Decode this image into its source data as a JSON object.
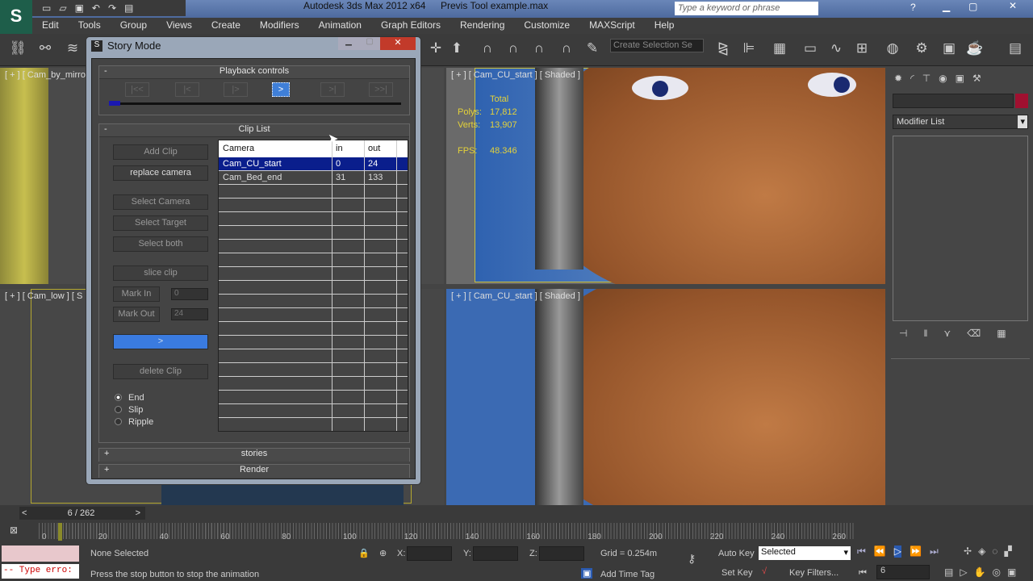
{
  "app": {
    "title": "Autodesk 3ds Max  2012 x64",
    "file": "Previs Tool example.max",
    "search_placeholder": "Type a keyword or phrase"
  },
  "menu": [
    "Edit",
    "Tools",
    "Group",
    "Views",
    "Create",
    "Modifiers",
    "Animation",
    "Graph Editors",
    "Rendering",
    "Customize",
    "MAXScript",
    "Help"
  ],
  "toolbar": {
    "selection_set": "Create Selection Se"
  },
  "viewports": {
    "top_left": "[ + ] [ Cam_by_mirror",
    "bottom_left": "[ + ] [ Cam_low ] [ S",
    "top_right": "[ + ] [ Cam_CU_start ] [ Shaded ]",
    "bottom_right": "[ + ] [ Cam_CU_start ] [ Shaded ]",
    "stats": {
      "total_label": "Total",
      "polys_label": "Polys:",
      "polys": "17,812",
      "verts_label": "Verts:",
      "verts": "13,907",
      "fps_label": "FPS:",
      "fps": "48.346"
    }
  },
  "command_panel": {
    "modifier_list": "Modifier List"
  },
  "dialog": {
    "title": "Story Mode",
    "playback": {
      "header": "Playback controls",
      "collapse": "-",
      "buttons": [
        "|<<",
        "|<",
        "|>",
        ">",
        ">|",
        ">>|"
      ],
      "progress": 0.02
    },
    "clip_list": {
      "header": "Clip List",
      "collapse": "-",
      "buttons": {
        "add": "Add Clip",
        "replace": "replace camera",
        "select_camera": "Select Camera",
        "select_target": "Select Target",
        "select_both": "Select both",
        "slice": "slice clip",
        "mark_in": "Mark In",
        "mark_out": "Mark Out",
        "go": ">",
        "delete": "delete Clip"
      },
      "mark_in_value": "0",
      "mark_out_value": "24",
      "columns": [
        "Camera",
        "in",
        "out"
      ],
      "rows": [
        {
          "camera": "Cam_CU_start",
          "in": "0",
          "out": "24"
        },
        {
          "camera": "Cam_Bed_end",
          "in": "31",
          "out": "133"
        }
      ],
      "modes": [
        "End",
        "Slip",
        "Ripple"
      ]
    },
    "stories": {
      "header": "stories",
      "expand": "+"
    },
    "render": {
      "header": "Render",
      "expand": "+"
    }
  },
  "timeline": {
    "frame": "6 / 262",
    "prev": "<",
    "next": ">",
    "ticks": [
      "0",
      "20",
      "40",
      "60",
      "80",
      "100",
      "120",
      "140",
      "160",
      "180",
      "200",
      "220",
      "240",
      "260"
    ]
  },
  "status": {
    "selection": "None Selected",
    "prompt": "Press the stop button to stop the animation",
    "script_error": "-- Type erro:",
    "x_label": "X:",
    "y_label": "Y:",
    "z_label": "Z:",
    "grid": "Grid = 0.254m",
    "add_time_tag": "Add Time Tag",
    "auto_key": "Auto Key",
    "set_key": "Set Key",
    "key_mode": "Selected",
    "key_filters": "Key Filters...",
    "current_frame": "6"
  }
}
